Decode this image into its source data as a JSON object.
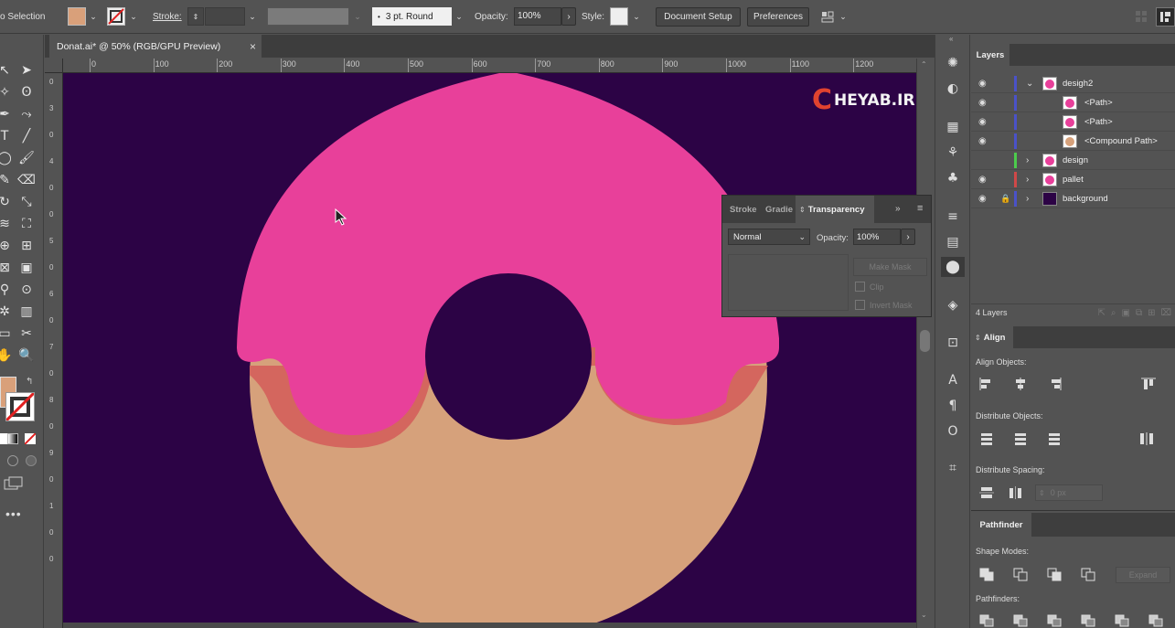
{
  "control_bar": {
    "selection_label": "o Selection",
    "stroke_label": "Stroke:",
    "stroke_weight_value": "",
    "brush_value": "3 pt. Round",
    "opacity_label": "Opacity:",
    "opacity_value": "100%",
    "style_label": "Style:",
    "document_setup": "Document Setup",
    "preferences": "Preferences",
    "fill_color": "#d9a07a"
  },
  "document_tab": {
    "title": "Donat.ai* @ 50% (RGB/GPU Preview)",
    "close": "×"
  },
  "ruler": {
    "ticks": [
      "0",
      "100",
      "200",
      "300",
      "400",
      "500",
      "600",
      "700",
      "800",
      "900",
      "1000",
      "1100",
      "1200"
    ],
    "vertical_ticks": [
      "0",
      "3",
      "0",
      "4",
      "0",
      "0",
      "5",
      "0",
      "6",
      "0",
      "7",
      "0",
      "8",
      "0",
      "9",
      "0",
      "1",
      "0",
      "0"
    ]
  },
  "artwork": {
    "watermark": "HEYAB.IR",
    "watermark_letter": "C",
    "background_color": "#2c0345",
    "icing_color": "#e8409a",
    "dough_color": "#d6a17b",
    "drip_color": "#d4665e"
  },
  "transparency_panel": {
    "tabs": [
      "Stroke",
      "Gradie",
      "Transparency"
    ],
    "blend_mode": "Normal",
    "opacity_label": "Opacity:",
    "opacity_value": "100%",
    "make_mask": "Make Mask",
    "clip": "Clip",
    "invert_mask": "Invert Mask"
  },
  "layers_panel": {
    "tab": "Layers",
    "count": "4 Layers",
    "rows": [
      {
        "name": "desigh2",
        "color": "#4a52c8",
        "expanded": true,
        "visible": true,
        "locked": false,
        "indent": 0
      },
      {
        "name": "<Path>",
        "color": "#4a52c8",
        "visible": true,
        "locked": false,
        "indent": 1
      },
      {
        "name": "<Path>",
        "color": "#4a52c8",
        "visible": true,
        "locked": false,
        "indent": 1
      },
      {
        "name": "<Compound Path>",
        "color": "#4a52c8",
        "visible": true,
        "locked": false,
        "indent": 1
      },
      {
        "name": "design",
        "color": "#4ccc4c",
        "visible": false,
        "locked": false,
        "indent": 0
      },
      {
        "name": "pallet",
        "color": "#d04848",
        "visible": true,
        "locked": false,
        "indent": 0
      },
      {
        "name": "background",
        "color": "#4a52c8",
        "visible": true,
        "locked": true,
        "indent": 0
      }
    ]
  },
  "align_panel": {
    "title": "Align",
    "align_objects": "Align Objects:",
    "distribute_objects": "Distribute Objects:",
    "distribute_spacing": "Distribute Spacing:",
    "spacing_value": "0 px"
  },
  "pathfinder_panel": {
    "title": "Pathfinder",
    "shape_modes": "Shape Modes:",
    "expand": "Expand",
    "pathfinders": "Pathfinders:"
  }
}
